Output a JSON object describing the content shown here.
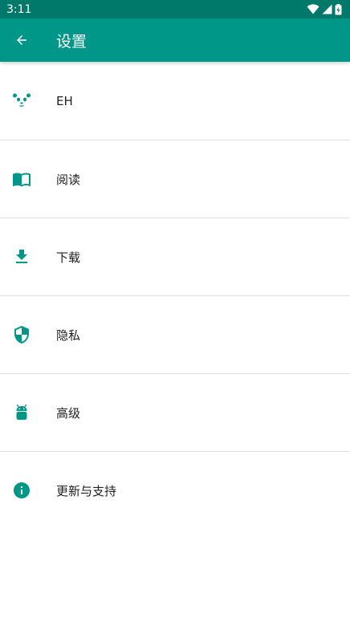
{
  "status_bar": {
    "time": "3:11",
    "icons": [
      "wifi-icon",
      "cellular-signal-icon",
      "battery-icon"
    ]
  },
  "toolbar": {
    "title": "设置",
    "back_icon": "arrow-back-icon"
  },
  "colors": {
    "primary": "#009688",
    "primary_dark": "#00796b",
    "divider": "#e0e0e0",
    "text": "#212121"
  },
  "menu": {
    "items": [
      {
        "label": "EH",
        "icon": "panda-icon"
      },
      {
        "label": "阅读",
        "icon": "book-open-icon"
      },
      {
        "label": "下载",
        "icon": "download-icon"
      },
      {
        "label": "隐私",
        "icon": "shield-icon"
      },
      {
        "label": "高级",
        "icon": "android-icon"
      },
      {
        "label": "更新与支持",
        "icon": "info-icon"
      }
    ]
  }
}
